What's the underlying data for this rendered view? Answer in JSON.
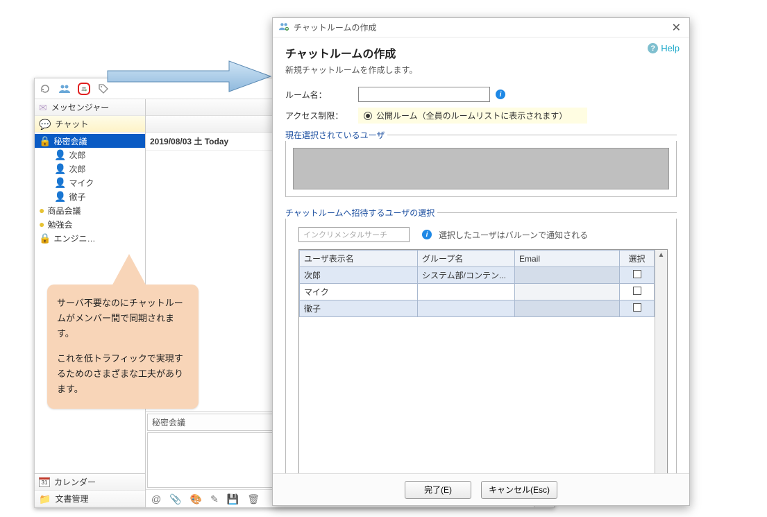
{
  "main": {
    "nav": {
      "messenger": "メッセンジャー",
      "chat": "チャット",
      "calendar": "カレンダー",
      "docs": "文書管理"
    },
    "rooms": [
      {
        "name": "秘密会議",
        "locked": true,
        "selected": true,
        "members": [
          {
            "name": "次郎",
            "gender": "m"
          },
          {
            "name": "次郎",
            "gender": "m"
          },
          {
            "name": "マイク",
            "gender": "m"
          },
          {
            "name": "徹子",
            "gender": "f"
          }
        ]
      },
      {
        "name": "商品会議",
        "locked": false
      },
      {
        "name": "勉強会",
        "locked": false
      },
      {
        "name": "エンジニ…",
        "locked": true
      }
    ],
    "center": {
      "docs_label": "文書管理",
      "messenger_label": "メッセンジャー",
      "date": "2019/08/03 土 Today",
      "target_room": "秘密会議"
    },
    "right_cal": "31"
  },
  "callout": {
    "p1": "サーバ不要なのにチャットルームがメンバー間で同期されます。",
    "p2": "これを低トラフィックで実現するためのさまざまな工夫があります。"
  },
  "dialog": {
    "window_title": "チャットルームの作成",
    "title": "チャットルームの作成",
    "subtitle": "新規チャットルームを作成します。",
    "help": "Help",
    "room_name_label": "ルーム名：",
    "room_name_value": "",
    "access_label": "アクセス制限：",
    "access_value": "公開ルーム（全員のルームリストに表示されます）",
    "selected_users_label": "現在選択されているユーザ",
    "invite_label": "チャットルームへ招待するユーザの選択",
    "search_placeholder": "インクリメンタルサーチ",
    "invite_hint": "選択したユーザはバルーンで通知される",
    "table": {
      "columns": {
        "name": "ユーザ表示名",
        "group": "グループ名",
        "email": "Email",
        "select": "選択"
      },
      "rows": [
        {
          "name": "次郎",
          "group": "システム部/コンテン...",
          "email": "",
          "selected": true
        },
        {
          "name": "マイク",
          "group": "",
          "email": ""
        },
        {
          "name": "徹子",
          "group": "",
          "email": "",
          "alt": true
        }
      ]
    },
    "buttons": {
      "ok": "完了(E)",
      "cancel": "キャンセル(Esc)"
    }
  }
}
